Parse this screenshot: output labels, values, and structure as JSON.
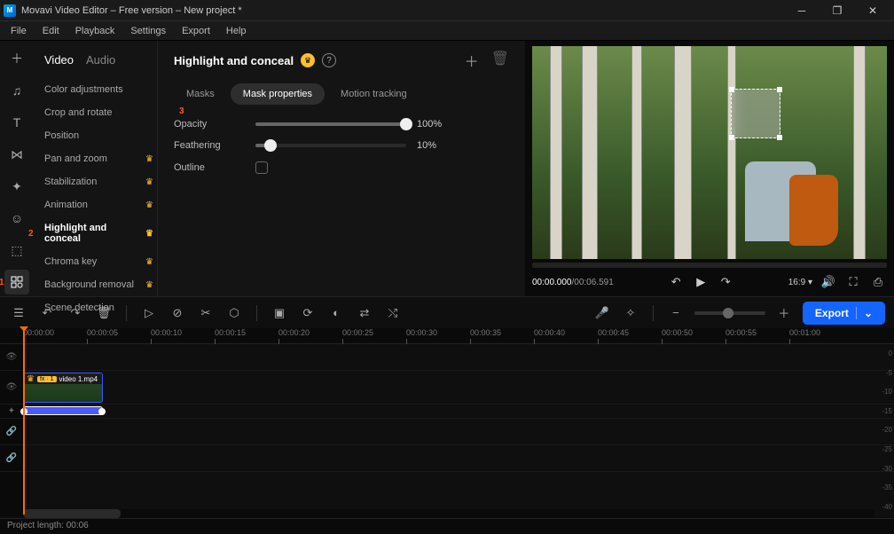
{
  "window": {
    "title": "Movavi Video Editor – Free version – New project *"
  },
  "menu": [
    "File",
    "Edit",
    "Playback",
    "Settings",
    "Export",
    "Help"
  ],
  "tabs": {
    "video": "Video",
    "audio": "Audio"
  },
  "effects": [
    {
      "label": "Color adjustments",
      "crown": false
    },
    {
      "label": "Crop and rotate",
      "crown": false
    },
    {
      "label": "Position",
      "crown": false
    },
    {
      "label": "Pan and zoom",
      "crown": true
    },
    {
      "label": "Stabilization",
      "crown": true
    },
    {
      "label": "Animation",
      "crown": true
    },
    {
      "label": "Highlight and conceal",
      "crown": true,
      "active": true
    },
    {
      "label": "Chroma key",
      "crown": true
    },
    {
      "label": "Background removal",
      "crown": true
    },
    {
      "label": "Scene detection",
      "crown": false
    }
  ],
  "center": {
    "title": "Highlight and conceal",
    "subtabs": [
      "Masks",
      "Mask properties",
      "Motion tracking"
    ],
    "active_subtab": 1,
    "props": {
      "opacity_label": "Opacity",
      "opacity_value": "100%",
      "opacity_pct": 100,
      "feather_label": "Feathering",
      "feather_value": "10%",
      "feather_pct": 10,
      "outline_label": "Outline"
    }
  },
  "preview": {
    "timecode_current": "00:00.000",
    "timecode_total": "00:06.591",
    "ratio": "16:9"
  },
  "timeline": {
    "ruler": [
      "00:00:00",
      "00:00:05",
      "00:00:10",
      "00:00:15",
      "00:00:20",
      "00:00:25",
      "00:00:30",
      "00:00:35",
      "00:00:40",
      "00:00:45",
      "00:00:50",
      "00:00:55",
      "00:01:00"
    ],
    "clip": {
      "fx_badge": "fx · 1",
      "name": "video 1.mp4"
    },
    "db": [
      "0",
      "-5",
      "-10",
      "-15",
      "-20",
      "-25",
      "-30",
      "-35",
      "-40"
    ]
  },
  "export_label": "Export",
  "status": "Project length: 00:06",
  "markers": {
    "rail": "1",
    "effect": "2",
    "subtab": "3"
  }
}
